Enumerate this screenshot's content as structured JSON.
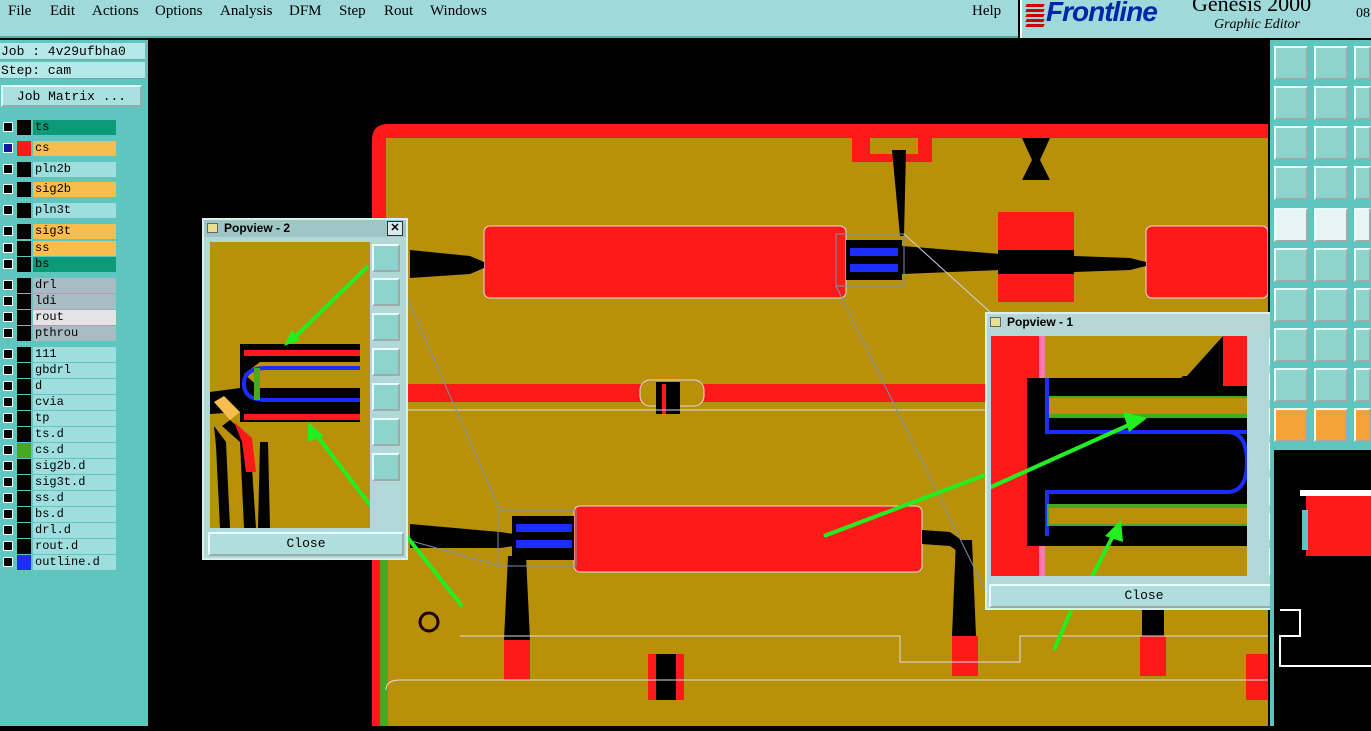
{
  "menu": {
    "items": [
      "File",
      "Edit",
      "Actions",
      "Options",
      "Analysis",
      "DFM",
      "Step",
      "Rout",
      "Windows"
    ],
    "help": "Help"
  },
  "brand": {
    "logo": "Frontline",
    "product": "Genesis 2000",
    "subtitle": "Graphic Editor",
    "clock": "08:"
  },
  "job": {
    "job_line": "Job : 4v29ufbha0",
    "step_line": "Step: cam",
    "matrix_button": "Job Matrix ..."
  },
  "layers": [
    {
      "name": "ts",
      "color": "#0c9a78",
      "swatch": "#000000",
      "active": false
    },
    {
      "name": "cs",
      "color": "#f7be4f",
      "swatch": "#ff1a1a",
      "active": true
    },
    {
      "name": "pln2b",
      "color": "#9fdede",
      "swatch": "#000000",
      "active": false
    },
    {
      "name": "sig2b",
      "color": "#f7be4f",
      "swatch": "#000000",
      "active": false
    },
    {
      "name": "pln3t",
      "color": "#9fdede",
      "swatch": "#000000",
      "active": false
    },
    {
      "name": "sig3t",
      "color": "#f7be4f",
      "swatch": "#000000",
      "active": false
    },
    {
      "name": "ss",
      "color": "#f7be4f",
      "swatch": "#000000",
      "active": false
    },
    {
      "name": "bs",
      "color": "#0c9a78",
      "swatch": "#000000",
      "active": false
    },
    {
      "name": "drl",
      "color": "#a9bcc4",
      "swatch": "#000000",
      "active": false
    },
    {
      "name": "ldi",
      "color": "#a9bcc4",
      "swatch": "#000000",
      "active": false
    },
    {
      "name": "rout",
      "color": "#e4e4e4",
      "swatch": "#000000",
      "active": false
    },
    {
      "name": "pthrou",
      "color": "#a9bcc4",
      "swatch": "#000000",
      "active": false
    },
    {
      "name": "111",
      "color": "#9fdede",
      "swatch": "#000000",
      "active": false
    },
    {
      "name": "gbdrl",
      "color": "#9fdede",
      "swatch": "#000000",
      "active": false
    },
    {
      "name": "d",
      "color": "#9fdede",
      "swatch": "#000000",
      "active": false
    },
    {
      "name": "cvia",
      "color": "#9fdede",
      "swatch": "#000000",
      "active": false
    },
    {
      "name": "tp",
      "color": "#9fdede",
      "swatch": "#000000",
      "active": false
    },
    {
      "name": "ts.d",
      "color": "#9fdede",
      "swatch": "#000000",
      "active": false
    },
    {
      "name": "cs.d",
      "color": "#9fdede",
      "swatch": "#44aa22",
      "active": false
    },
    {
      "name": "sig2b.d",
      "color": "#9fdede",
      "swatch": "#000000",
      "active": false
    },
    {
      "name": "sig3t.d",
      "color": "#9fdede",
      "swatch": "#000000",
      "active": false
    },
    {
      "name": "ss.d",
      "color": "#9fdede",
      "swatch": "#000000",
      "active": false
    },
    {
      "name": "bs.d",
      "color": "#9fdede",
      "swatch": "#000000",
      "active": false
    },
    {
      "name": "drl.d",
      "color": "#9fdede",
      "swatch": "#000000",
      "active": false
    },
    {
      "name": "rout.d",
      "color": "#9fdede",
      "swatch": "#000000",
      "active": false
    },
    {
      "name": "outline.d",
      "color": "#9fdede",
      "swatch": "#1b2dff",
      "active": false
    }
  ],
  "popview2": {
    "title": "Popview - 2",
    "close": "Close"
  },
  "popview1": {
    "title": "Popview - 1",
    "close": "Close"
  },
  "colors": {
    "board": "#b8900a",
    "copper": "#ff1a1a",
    "trace_blue": "#1b2dff",
    "trace_green": "#44aa22",
    "arrow": "#22ee22",
    "panel": "#5fc6bf"
  }
}
